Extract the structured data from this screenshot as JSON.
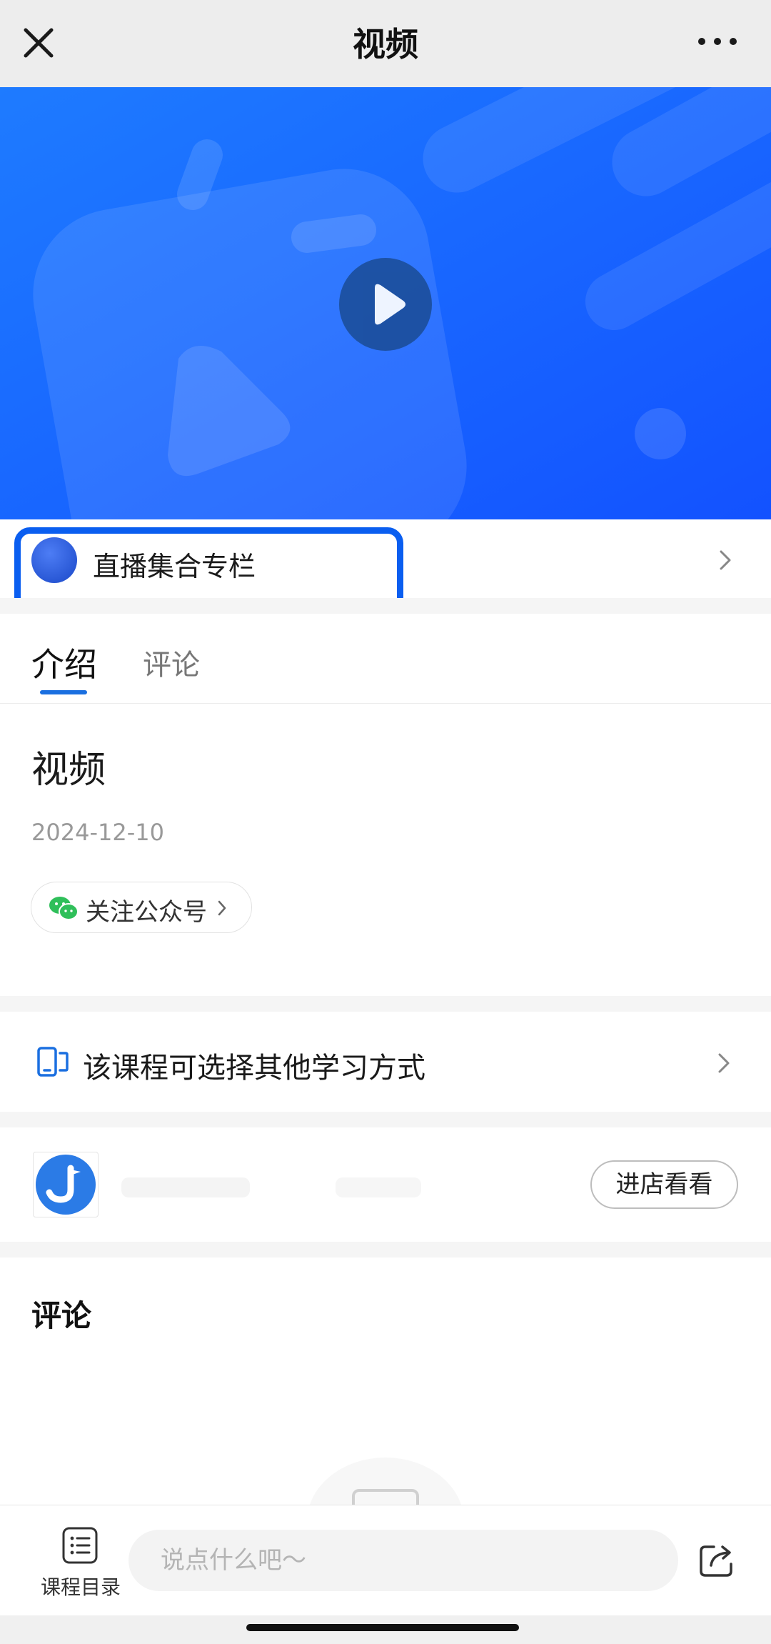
{
  "header": {
    "title": "视频",
    "close_icon": "close-icon",
    "more_icon": "more-dots-icon"
  },
  "video": {
    "play_icon": "play-icon",
    "colors": {
      "bg_start": "#1e7bff",
      "bg_end": "#1352ff"
    }
  },
  "column": {
    "title": "直播集合专栏",
    "highlight_color": "#0a5ef0"
  },
  "tabs": [
    {
      "label": "介绍",
      "active": true
    },
    {
      "label": "评论",
      "active": false
    }
  ],
  "intro": {
    "title": "视频",
    "date": "2024-12-10",
    "follow_label": "关注公众号",
    "wechat_color": "#2fbf5a"
  },
  "study_mode": {
    "label": "该课程可选择其他学习方式",
    "icon": "device-switch-icon"
  },
  "shop": {
    "button_label": "进店看看",
    "logo_color": "#2b7be6"
  },
  "comments": {
    "title": "评论"
  },
  "bottom_bar": {
    "catalog_label": "课程目录",
    "input_placeholder": "说点什么吧～",
    "share_icon": "share-icon"
  },
  "accent": "#1a6fe0"
}
